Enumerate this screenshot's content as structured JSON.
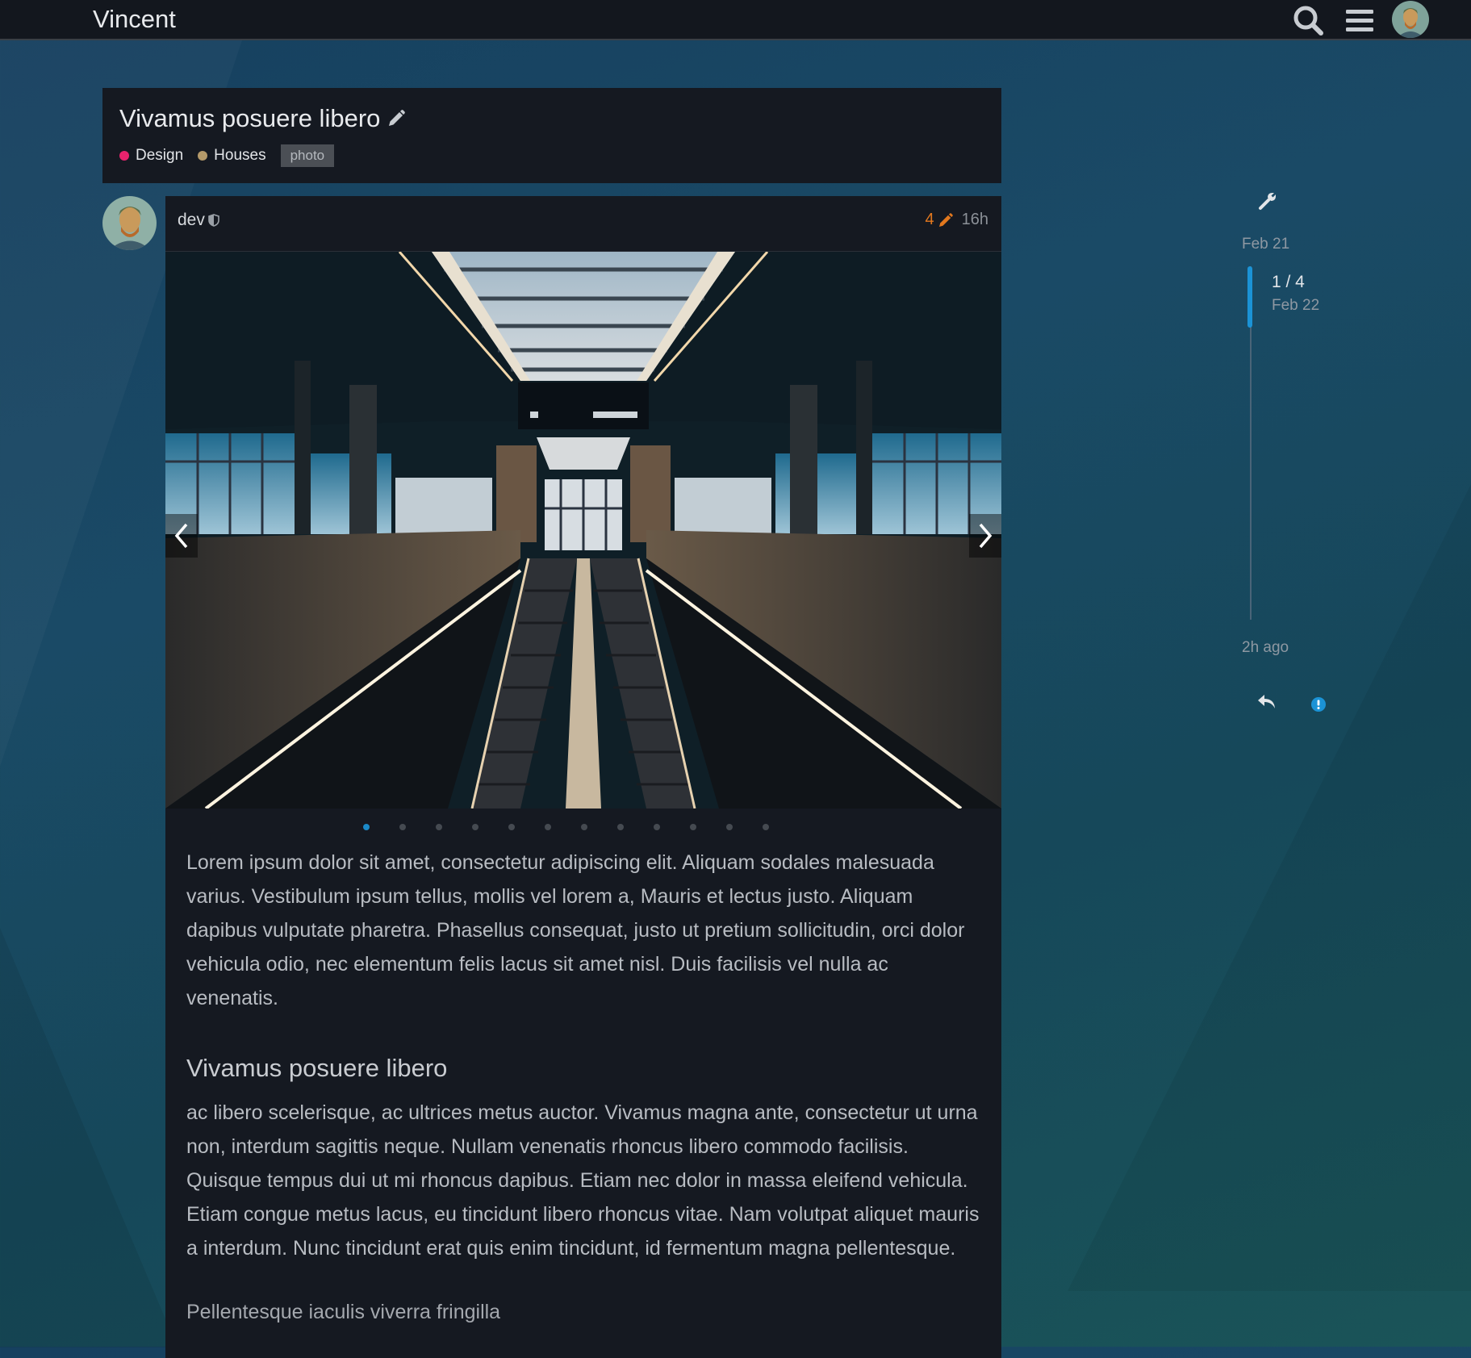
{
  "header": {
    "site_title": "Vincent",
    "icons": [
      "search-icon",
      "hamburger-menu-icon",
      "user-avatar"
    ]
  },
  "topic": {
    "title": "Vivamus posuere libero",
    "categories": [
      {
        "name": "Design",
        "color": "#e8236d"
      },
      {
        "name": "Houses",
        "color": "#b59a6a"
      }
    ],
    "tag": "photo"
  },
  "post": {
    "username": "dev",
    "edit_count": "4",
    "age": "16h",
    "gallery": {
      "total_slides": 12,
      "active_index": 0
    },
    "paragraph_1": "Lorem ipsum dolor sit amet, consectetur adipiscing elit. Aliquam sodales malesuada varius. Vestibulum ipsum tellus, mollis vel lorem a, Mauris et lectus justo. Aliquam dapibus vulputate pharetra. Phasellus consequat, justo ut pretium sollicitudin, orci dolor vehicula odio, nec elementum felis lacus sit amet nisl. Duis facilisis vel nulla ac venenatis.",
    "heading_1": "Vivamus posuere libero",
    "paragraph_2": "ac libero scelerisque, ac ultrices metus auctor. Vivamus magna ante, consectetur ut urna non, interdum sagittis neque. Nullam venenatis rhoncus libero commodo facilisis. Quisque tempus dui ut mi rhoncus dapibus. Etiam nec dolor in massa eleifend vehicula. Etiam congue metus lacus, eu tincidunt libero rhoncus vitae. Nam volutpat aliquet mauris a interdum. Nunc tincidunt erat quis enim tincidunt, id fermentum magna pellentesque.",
    "heading_2": "Pellentesque iaculis viverra fringilla"
  },
  "timeline": {
    "start_date": "Feb 21",
    "position": "1 / 4",
    "position_date": "Feb 22",
    "end_label": "2h ago",
    "accent": "#1b93d6"
  }
}
